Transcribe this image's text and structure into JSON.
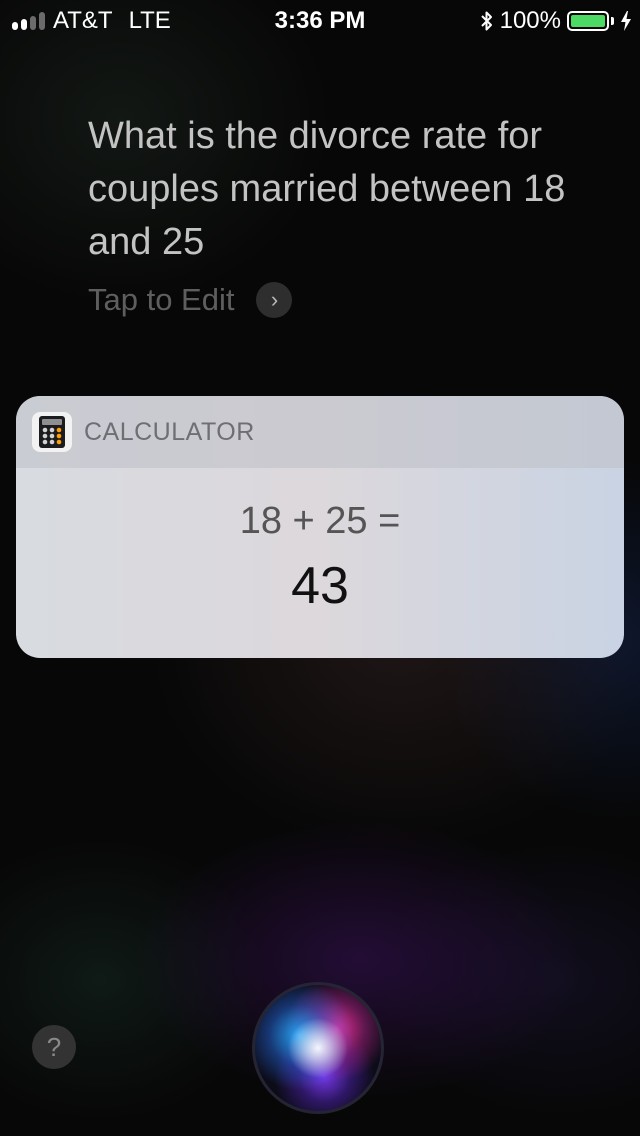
{
  "status_bar": {
    "carrier": "AT&T",
    "network": "LTE",
    "time": "3:36 PM",
    "battery": "100%",
    "battery_level": 1.0,
    "signal_bars_filled": 2,
    "signal_bars_total": 4
  },
  "query": {
    "text": "What is the divorce rate for couples married between 18 and 25",
    "tap_to_edit": "Tap to Edit",
    "chevron": "›"
  },
  "card": {
    "app_name": "CALCULATOR",
    "equation": "18 + 25 =",
    "result": "43"
  },
  "bottom": {
    "help_label": "?"
  },
  "colors": {
    "battery_green": "#4cd964",
    "background": "#070707"
  },
  "icons": [
    "signal-icon",
    "bluetooth-icon",
    "battery-icon",
    "charging-icon",
    "chevron-right-icon",
    "calculator-icon",
    "siri-orb-icon"
  ]
}
